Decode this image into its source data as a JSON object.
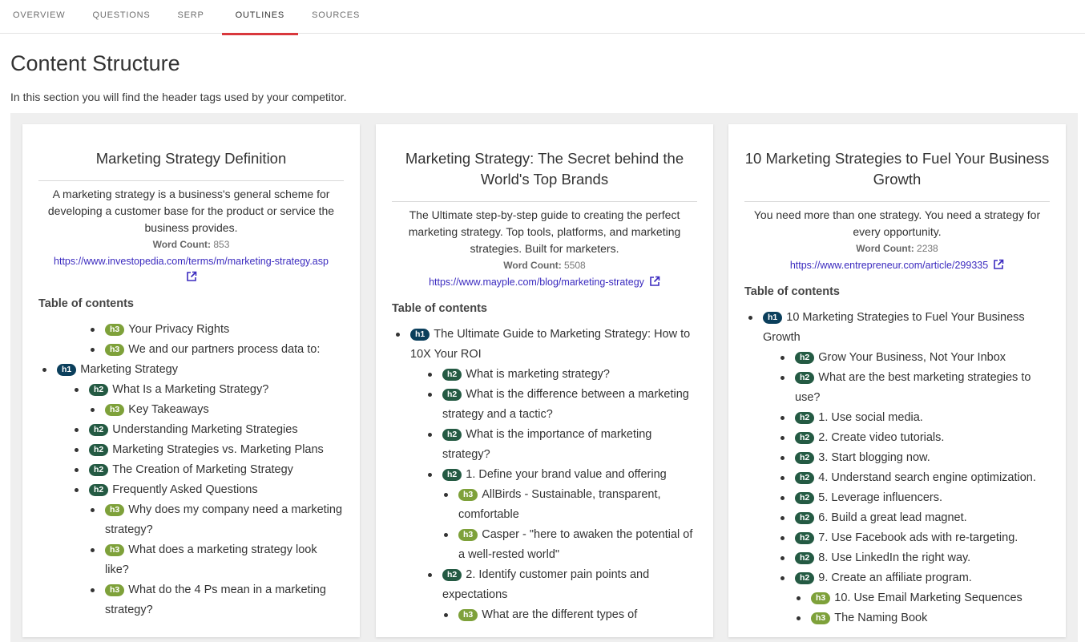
{
  "tabs": [
    {
      "label": "OVERVIEW"
    },
    {
      "label": "QUESTIONS"
    },
    {
      "label": "SERP"
    },
    {
      "label": "OUTLINES",
      "active": true
    },
    {
      "label": "SOURCES"
    }
  ],
  "page": {
    "title": "Content Structure",
    "subtitle": "In this section you will find the header tags used by your competitor."
  },
  "colors": {
    "accent": "#d9383d",
    "h1": "#0b3f5c",
    "h2": "#245a43",
    "h3": "#7ea13a",
    "link": "#3b2bbf"
  },
  "word_count_label": "Word Count:",
  "toc_heading": "Table of contents",
  "cards": [
    {
      "title": "Marketing Strategy Definition",
      "description": "A marketing strategy is a business's general scheme for developing a customer base for the product or service the business provides.",
      "word_count": "853",
      "url": "https://www.investopedia.com/terms/m/marketing-strategy.asp",
      "toc": [
        {
          "level": 3,
          "tag": "h3",
          "text": "Your Privacy Rights"
        },
        {
          "level": 3,
          "tag": "h3",
          "text": "We and our partners process data to:"
        },
        {
          "level": 1,
          "tag": "h1",
          "text": "Marketing Strategy"
        },
        {
          "level": 2,
          "tag": "h2",
          "text": "What Is a Marketing Strategy?"
        },
        {
          "level": 3,
          "tag": "h3",
          "text": "Key Takeaways"
        },
        {
          "level": 2,
          "tag": "h2",
          "text": "Understanding Marketing Strategies"
        },
        {
          "level": 2,
          "tag": "h2",
          "text": "Marketing Strategies vs. Marketing Plans"
        },
        {
          "level": 2,
          "tag": "h2",
          "text": "The Creation of Marketing Strategy"
        },
        {
          "level": 2,
          "tag": "h2",
          "text": "Frequently Asked Questions"
        },
        {
          "level": 3,
          "tag": "h3",
          "text": "Why does my company need a marketing strategy?"
        },
        {
          "level": 3,
          "tag": "h3",
          "text": "What does a marketing strategy look like?"
        },
        {
          "level": 3,
          "tag": "h3",
          "text": "What do the 4 Ps mean in a marketing strategy?"
        }
      ]
    },
    {
      "title": "Marketing Strategy: The Secret behind the World's Top Brands",
      "description": "The Ultimate step-by-step guide to creating the perfect marketing strategy. Top tools, platforms, and marketing strategies. Built for marketers.",
      "word_count": "5508",
      "url": "https://www.mayple.com/blog/marketing-strategy",
      "toc": [
        {
          "level": 1,
          "tag": "h1",
          "text": "The Ultimate Guide to Marketing Strategy: How to 10X Your ROI"
        },
        {
          "level": 2,
          "tag": "h2",
          "text": "What is marketing strategy?"
        },
        {
          "level": 2,
          "tag": "h2",
          "text": "What is the difference between a marketing strategy and a tactic?"
        },
        {
          "level": 2,
          "tag": "h2",
          "text": "What is the importance of marketing strategy?"
        },
        {
          "level": 2,
          "tag": "h2",
          "text": "1. Define your brand value and offering"
        },
        {
          "level": 3,
          "tag": "h3",
          "text": "AllBirds - Sustainable, transparent, comfortable"
        },
        {
          "level": 3,
          "tag": "h3",
          "text": "Casper - \"here to awaken the potential of a well-rested world\""
        },
        {
          "level": 2,
          "tag": "h2",
          "text": "2. Identify customer pain points and expectations"
        },
        {
          "level": 3,
          "tag": "h3",
          "text": "What are the different types of"
        }
      ]
    },
    {
      "title": "10 Marketing Strategies to Fuel Your Business Growth",
      "description": "You need more than one strategy. You need a strategy for every opportunity.",
      "word_count": "2238",
      "url": "https://www.entrepreneur.com/article/299335",
      "toc": [
        {
          "level": 1,
          "tag": "h1",
          "text": "10 Marketing Strategies to Fuel Your Business Growth"
        },
        {
          "level": 2,
          "tag": "h2",
          "text": "Grow Your Business, Not Your Inbox"
        },
        {
          "level": 2,
          "tag": "h2",
          "text": "What are the best marketing strategies to use?"
        },
        {
          "level": 2,
          "tag": "h2",
          "text": "1. Use social media."
        },
        {
          "level": 2,
          "tag": "h2",
          "text": "2. Create video tutorials."
        },
        {
          "level": 2,
          "tag": "h2",
          "text": "3. Start blogging now."
        },
        {
          "level": 2,
          "tag": "h2",
          "text": "4. Understand search engine optimization."
        },
        {
          "level": 2,
          "tag": "h2",
          "text": "5. Leverage influencers."
        },
        {
          "level": 2,
          "tag": "h2",
          "text": "6. Build a great lead magnet."
        },
        {
          "level": 2,
          "tag": "h2",
          "text": "7. Use Facebook ads with re-targeting."
        },
        {
          "level": 2,
          "tag": "h2",
          "text": "8. Use LinkedIn the right way."
        },
        {
          "level": 2,
          "tag": "h2",
          "text": "9. Create an affiliate program."
        },
        {
          "level": 3,
          "tag": "h3",
          "text": "10. Use Email Marketing Sequences"
        },
        {
          "level": 3,
          "tag": "h3",
          "text": "The Naming Book"
        }
      ]
    }
  ]
}
